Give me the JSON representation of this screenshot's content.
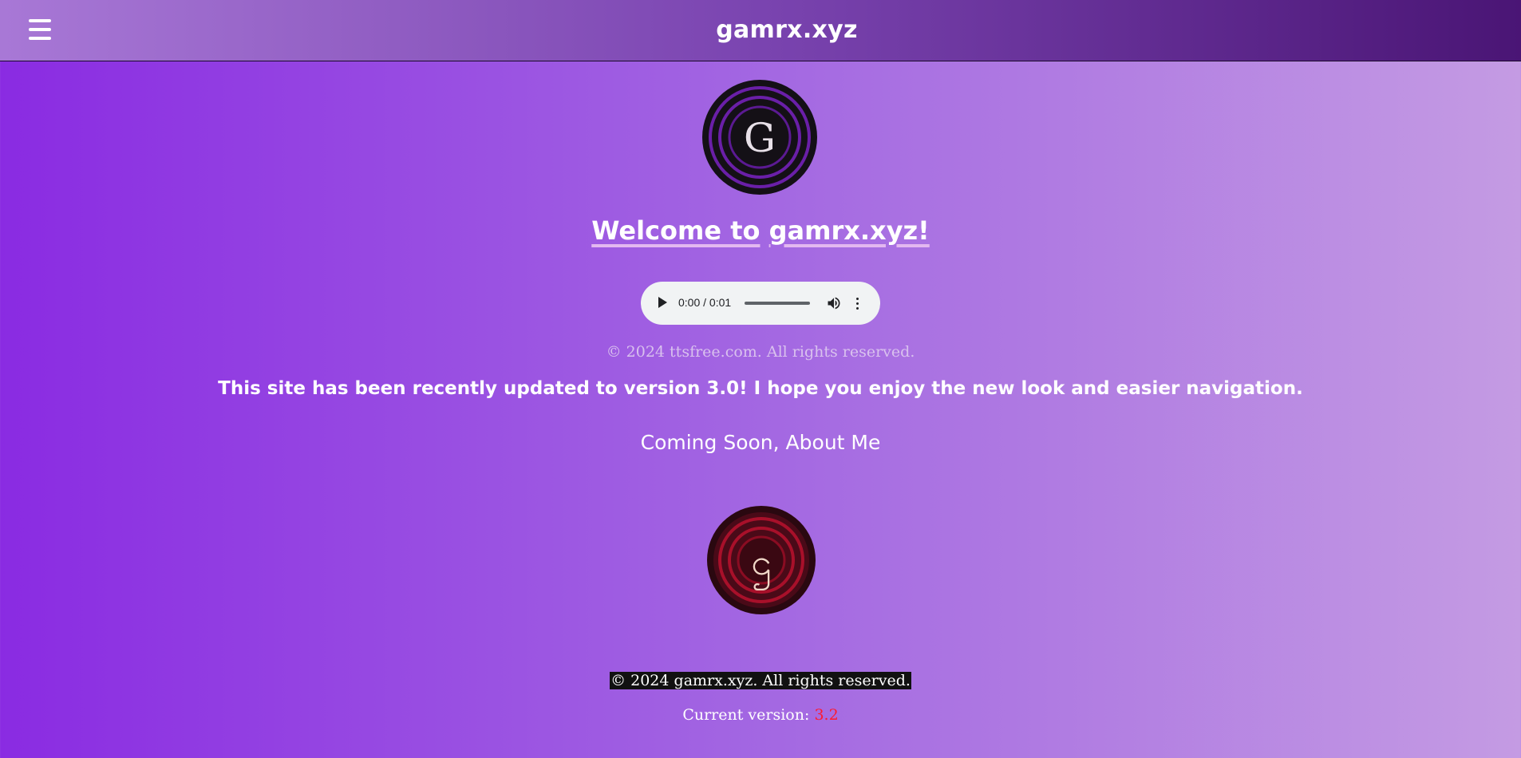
{
  "header": {
    "title": "gamrx.xyz",
    "menu_icon": "hamburger-menu-icon"
  },
  "logos": {
    "top_letter": "G",
    "bottom_letter": "ဌ"
  },
  "welcome": {
    "part1": "Welcome to",
    "part2": "gamrx.xyz!"
  },
  "audio": {
    "time": "0:00 / 0:01",
    "play_icon": "play-icon",
    "volume_icon": "volume-icon",
    "more_icon": "more-vertical-icon"
  },
  "tts_copyright": "© 2024 ttsfree.com. All rights reserved.",
  "update_message": "This site has been recently updated to version 3.0! I hope you enjoy the new look and easier navigation.",
  "links": {
    "coming_soon": "Coming Soon",
    "separator": ",",
    "about_me": "About Me"
  },
  "footer": {
    "copyright": "© 2024 gamrx.xyz. All rights reserved.",
    "version_label": "Current version:",
    "version_number": "3.2"
  },
  "colors": {
    "accent_purple": "#8a2be2",
    "version_red": "#ff1a2e",
    "logo_top_ring": "#6a1fa8",
    "logo_bottom_ring": "#a8102a"
  }
}
